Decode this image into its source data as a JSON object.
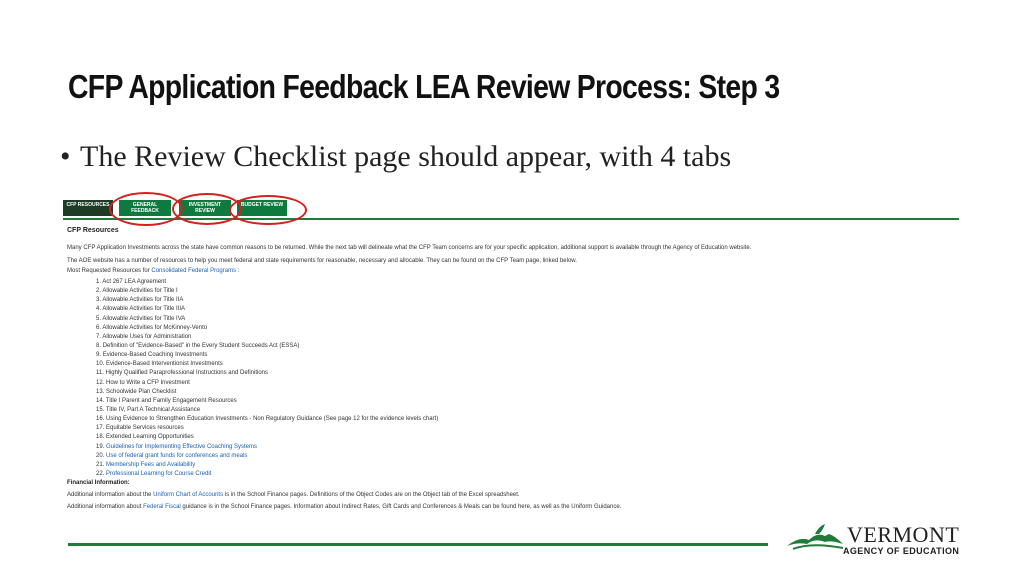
{
  "slide": {
    "title": "CFP Application Feedback LEA Review Process: Step 3",
    "bullet": "The Review Checklist page should appear, with 4 tabs"
  },
  "tabs": [
    {
      "label": "CFP RESOURCES"
    },
    {
      "label": "GENERAL FEEDBACK"
    },
    {
      "label": "INVESTMENT REVIEW"
    },
    {
      "label": "BUDGET REVIEW"
    }
  ],
  "resources": {
    "header": "CFP Resources",
    "intro1": "Many CFP Application Investments across the state have common reasons to be returned.  While the next tab will delineate what the CFP Team concerns are for your specific application, additional support is available through the Agency of Education website.",
    "intro2": "The AOE website has a number of resources to help you meet federal and state requirements for reasonable, necessary and allocable. They can be found on the CFP Team page, linked below.",
    "most_requested_prefix": "Most Requested Resources for ",
    "most_requested_link": "Consolidated Federal Programs",
    "most_requested_suffix": " :",
    "items": [
      {
        "num": "1.",
        "text": "Act 267 LEA Agreement",
        "link": false
      },
      {
        "num": "2.",
        "text": "Allowable Activities for Title I",
        "link": false
      },
      {
        "num": "3.",
        "text": "Allowable Activities for Title IIA",
        "link": false
      },
      {
        "num": "4.",
        "text": "Allowable Activities for Title IIIA",
        "link": false
      },
      {
        "num": "5.",
        "text": "Allowable Activities for Title IVA",
        "link": false
      },
      {
        "num": "6.",
        "text": "Allowable Activities for McKinney-Vento",
        "link": false
      },
      {
        "num": "7.",
        "text": "Allowable Uses for Administration",
        "link": false
      },
      {
        "num": "8.",
        "text": "Definition of \"Evidence-Based\" in the Every Student Succeeds Act (ESSA)",
        "link": false
      },
      {
        "num": "9.",
        "text": "Evidence-Based Coaching Investments",
        "link": false
      },
      {
        "num": "10.",
        "text": "Evidence-Based Interventionist Investments",
        "link": false
      },
      {
        "num": "11.",
        "text": "Highly Qualified Paraprofessional Instructions and Definitions",
        "link": false
      },
      {
        "num": "12.",
        "text": "How to Write a CFP Investment",
        "link": false
      },
      {
        "num": "13.",
        "text": "Schoolwide Plan Checklist",
        "link": false
      },
      {
        "num": "14.",
        "text": "Title I Parent and Family Engagement Resources",
        "link": false
      },
      {
        "num": "15.",
        "text": "Title IV, Part A Technical Assistance",
        "link": false
      },
      {
        "num": "16.",
        "text": "Using Evidence to Strengthen Education Investments - Non Regulatory Guidance  (See page 12 for the evidence levels chart)",
        "link": false
      },
      {
        "num": "17.",
        "text": "Equitable Services resources",
        "link": false
      },
      {
        "num": "18.",
        "text": "Extended Learning Opportunities",
        "link": false
      },
      {
        "num": "19.",
        "text": "Guidelines for Implementing Effective Coaching Systems",
        "link": true
      },
      {
        "num": "20.",
        "text": "Use of federal grant funds for conferences and meals",
        "link": true
      },
      {
        "num": "21.",
        "text": "Membership Fees and Availability",
        "link": true
      },
      {
        "num": "22.",
        "text": "Professional Learning for Course Credit",
        "link": true
      }
    ],
    "financial_header": "Financial Information:",
    "fin1_prefix": "Additional information about the ",
    "fin1_link": "Uniform Chart of Accounts",
    "fin1_suffix": "  is in the School Finance pages.  Definitions of the Object Codes are on the Object tab of the Excel spreadsheet.",
    "fin2_prefix": "Additional information about ",
    "fin2_link": "Federal Fiscal",
    "fin2_suffix": "  guidance is in the School Finance pages.  Information about Indirect Rates, Gift Cards and Conferences & Meals can be found here, as well as the Uniform Guidance."
  },
  "logo": {
    "word": "VERMONT",
    "sub": "AGENCY OF EDUCATION"
  },
  "colors": {
    "tab_green": "#0f7a3f",
    "annotation_red": "#d42020",
    "link_blue": "#1a5fb4"
  }
}
